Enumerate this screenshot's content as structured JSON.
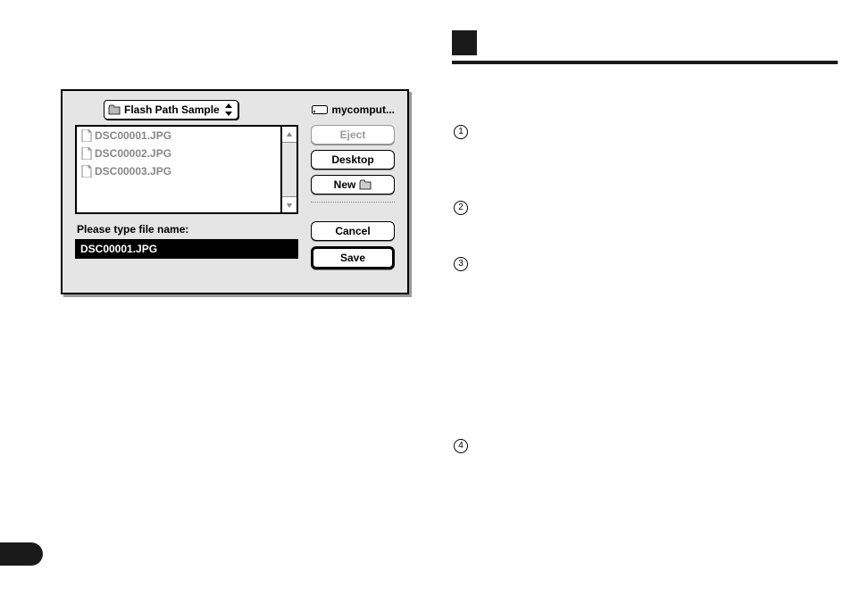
{
  "dialog": {
    "location_label": "Flash Path Sample",
    "disk_label": "mycomput...",
    "files": [
      "DSC00001.JPG",
      "DSC00002.JPG",
      "DSC00003.JPG"
    ],
    "prompt": "Please type file name:",
    "filename_value": "DSC00001.JPG",
    "buttons": {
      "eject": "Eject",
      "desktop": "Desktop",
      "new": "New",
      "cancel": "Cancel",
      "save": "Save"
    }
  },
  "steps": {
    "one": "1",
    "two": "2",
    "three": "3",
    "four": "4"
  }
}
